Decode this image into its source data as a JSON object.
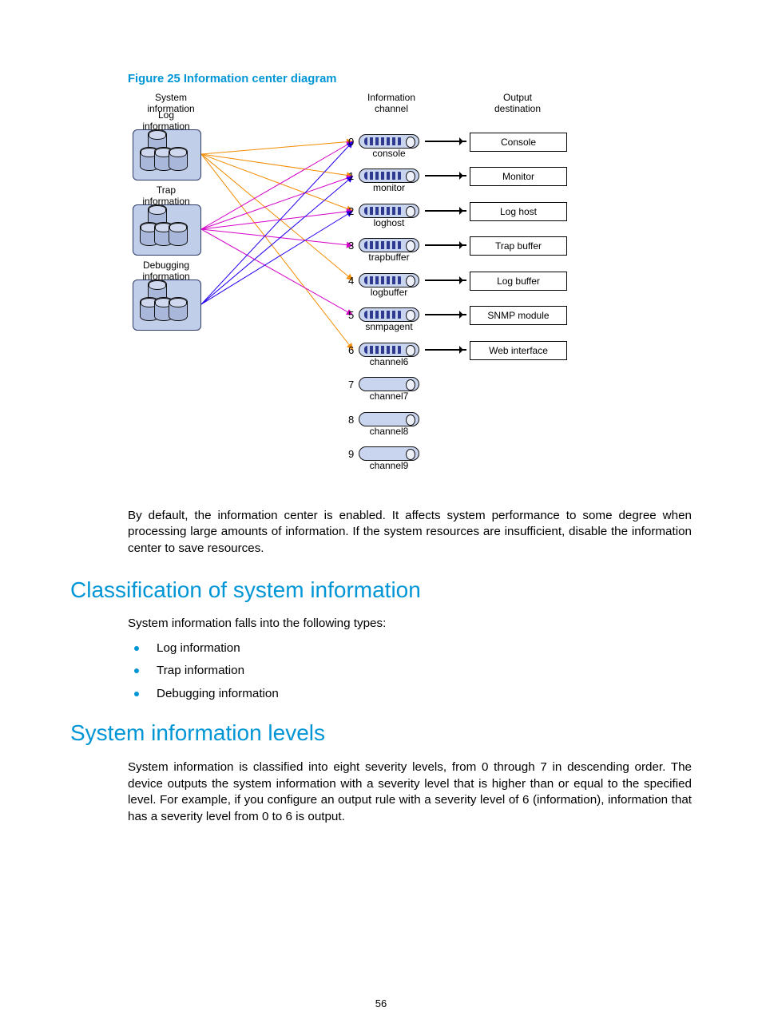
{
  "figure": {
    "caption": "Figure 25 Information center diagram",
    "col_headers": {
      "left": "System\ninformation",
      "mid": "Information\nchannel",
      "right": "Output\ndestination"
    },
    "sources": [
      {
        "label": "Log\ninformation"
      },
      {
        "label": "Trap\ninformation"
      },
      {
        "label": "Debugging\ninformation"
      }
    ],
    "channels": [
      {
        "num": "0",
        "name": "console",
        "dest": "Console",
        "has_dest": true,
        "full": true
      },
      {
        "num": "1",
        "name": "monitor",
        "dest": "Monitor",
        "has_dest": true,
        "full": true
      },
      {
        "num": "2",
        "name": "loghost",
        "dest": "Log host",
        "has_dest": true,
        "full": true
      },
      {
        "num": "3",
        "name": "trapbuffer",
        "dest": "Trap buffer",
        "has_dest": true,
        "full": true
      },
      {
        "num": "4",
        "name": "logbuffer",
        "dest": "Log buffer",
        "has_dest": true,
        "full": true
      },
      {
        "num": "5",
        "name": "snmpagent",
        "dest": "SNMP module",
        "has_dest": true,
        "full": true
      },
      {
        "num": "6",
        "name": "channel6",
        "dest": "Web interface",
        "has_dest": true,
        "full": true
      },
      {
        "num": "7",
        "name": "channel7",
        "dest": "",
        "has_dest": false,
        "full": false
      },
      {
        "num": "8",
        "name": "channel8",
        "dest": "",
        "has_dest": false,
        "full": false
      },
      {
        "num": "9",
        "name": "channel9",
        "dest": "",
        "has_dest": false,
        "full": false
      }
    ],
    "edges": [
      {
        "src": 0,
        "ch": 0,
        "color": "#f28c00"
      },
      {
        "src": 0,
        "ch": 1,
        "color": "#f28c00"
      },
      {
        "src": 0,
        "ch": 2,
        "color": "#f28c00"
      },
      {
        "src": 0,
        "ch": 4,
        "color": "#f28c00"
      },
      {
        "src": 0,
        "ch": 6,
        "color": "#f28c00"
      },
      {
        "src": 1,
        "ch": 0,
        "color": "#d400c8"
      },
      {
        "src": 1,
        "ch": 1,
        "color": "#d400c8"
      },
      {
        "src": 1,
        "ch": 2,
        "color": "#d400c8"
      },
      {
        "src": 1,
        "ch": 3,
        "color": "#d400c8"
      },
      {
        "src": 1,
        "ch": 5,
        "color": "#d400c8"
      },
      {
        "src": 2,
        "ch": 0,
        "color": "#2200ee"
      },
      {
        "src": 2,
        "ch": 1,
        "color": "#2200ee"
      },
      {
        "src": 2,
        "ch": 2,
        "color": "#2200ee"
      }
    ]
  },
  "paragraphs": {
    "intro_default": "By default, the information center is enabled. It affects system performance to some degree when processing large amounts of information. If the system resources are insufficient, disable the information center to save resources.",
    "class_lead": "System information falls into the following types:",
    "levels_body": "System information is classified into eight severity levels, from 0 through 7 in descending order. The device outputs the system information with a severity level that is higher than or equal to the specified level. For example, if you configure an output rule with a severity level of 6 (information), information that has a severity level from 0 to 6 is output."
  },
  "bullets_classification": [
    "Log information",
    "Trap information",
    "Debugging information"
  ],
  "headings": {
    "classification": "Classification of system information",
    "levels": "System information levels"
  },
  "page_number": "56"
}
